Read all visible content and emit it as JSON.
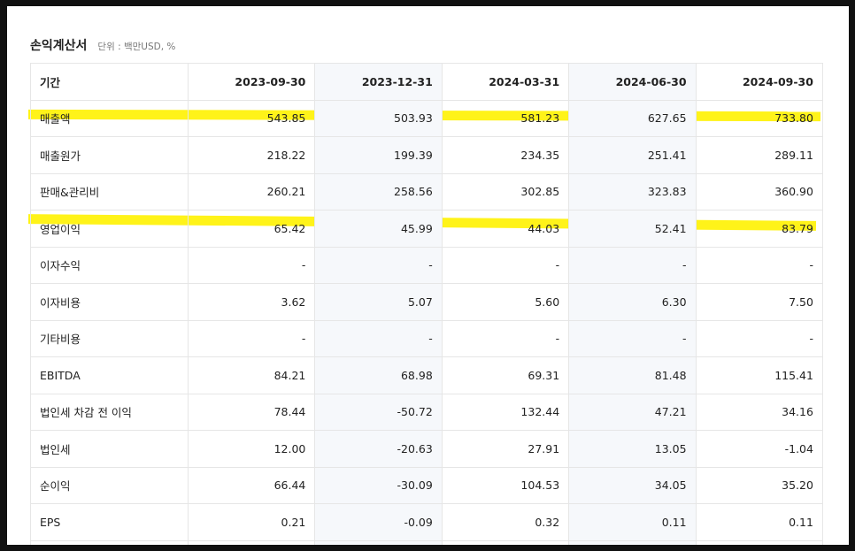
{
  "header": {
    "title": "손익계산서",
    "unit": "단위 : 백만USD, %"
  },
  "table": {
    "period_label": "기간",
    "periods": [
      "2023-09-30",
      "2023-12-31",
      "2024-03-31",
      "2024-06-30",
      "2024-09-30"
    ],
    "rows": [
      {
        "label": "매출액",
        "values": [
          "543.85",
          "503.93",
          "581.23",
          "627.65",
          "733.80"
        ],
        "highlighted": true
      },
      {
        "label": "매출원가",
        "values": [
          "218.22",
          "199.39",
          "234.35",
          "251.41",
          "289.11"
        ]
      },
      {
        "label": "판매&관리비",
        "values": [
          "260.21",
          "258.56",
          "302.85",
          "323.83",
          "360.90"
        ]
      },
      {
        "label": "영업이익",
        "values": [
          "65.42",
          "45.99",
          "44.03",
          "52.41",
          "83.79"
        ],
        "highlighted": true
      },
      {
        "label": "이자수익",
        "values": [
          "-",
          "-",
          "-",
          "-",
          "-"
        ]
      },
      {
        "label": "이자비용",
        "values": [
          "3.62",
          "5.07",
          "5.60",
          "6.30",
          "7.50"
        ]
      },
      {
        "label": "기타비용",
        "values": [
          "-",
          "-",
          "-",
          "-",
          "-"
        ]
      },
      {
        "label": "EBITDA",
        "values": [
          "84.21",
          "68.98",
          "69.31",
          "81.48",
          "115.41"
        ]
      },
      {
        "label": "법인세 차감 전 이익",
        "values": [
          "78.44",
          "-50.72",
          "132.44",
          "47.21",
          "34.16"
        ]
      },
      {
        "label": "법인세",
        "values": [
          "12.00",
          "-20.63",
          "27.91",
          "13.05",
          "-1.04"
        ]
      },
      {
        "label": "순이익",
        "values": [
          "66.44",
          "-30.09",
          "104.53",
          "34.05",
          "35.20"
        ]
      },
      {
        "label": "EPS",
        "values": [
          "0.21",
          "-0.09",
          "0.32",
          "0.11",
          "0.11"
        ]
      },
      {
        "label": "",
        "values": [
          "",
          "",
          "",
          "",
          ""
        ]
      }
    ]
  },
  "colors": {
    "highlight": "#fff200",
    "shade": "#f6f8fb",
    "border": "#e6e6e6"
  }
}
